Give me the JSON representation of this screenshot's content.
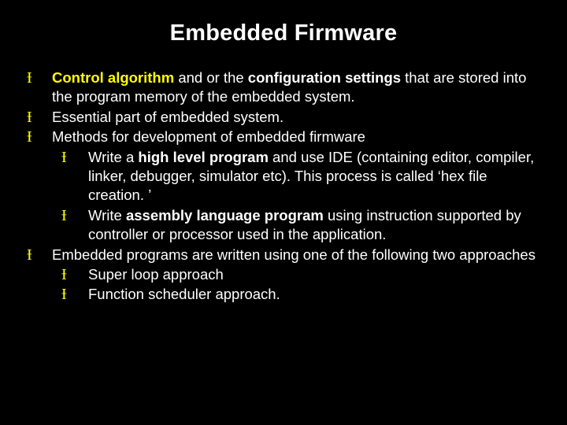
{
  "slide": {
    "title": "Embedded Firmware",
    "bullet_glyph": "Ɨ",
    "items": [
      {
        "runs": [
          {
            "t": "Control algorithm",
            "hl": true
          },
          {
            "t": " and or the "
          },
          {
            "t": "configuration settings",
            "b": true
          },
          {
            "t": " that are stored into the program memory of the embedded system."
          }
        ]
      },
      {
        "runs": [
          {
            "t": "Essential part of embedded system."
          }
        ]
      },
      {
        "runs": [
          {
            "t": "Methods for development of embedded firmware"
          }
        ],
        "children": [
          {
            "runs": [
              {
                "t": "Write a "
              },
              {
                "t": "high level program",
                "b": true
              },
              {
                "t": " and use IDE (containing editor, compiler, linker, debugger, simulator etc). This process is called ‘hex file creation. ’"
              }
            ]
          },
          {
            "runs": [
              {
                "t": "Write "
              },
              {
                "t": "assembly language program",
                "b": true
              },
              {
                "t": " using instruction supported by controller or processor used in the application."
              }
            ]
          }
        ]
      },
      {
        "runs": [
          {
            "t": "Embedded programs are written using one of the following two approaches"
          }
        ],
        "children": [
          {
            "runs": [
              {
                "t": "Super loop approach"
              }
            ]
          },
          {
            "runs": [
              {
                "t": "Function scheduler approach."
              }
            ]
          }
        ]
      }
    ]
  }
}
